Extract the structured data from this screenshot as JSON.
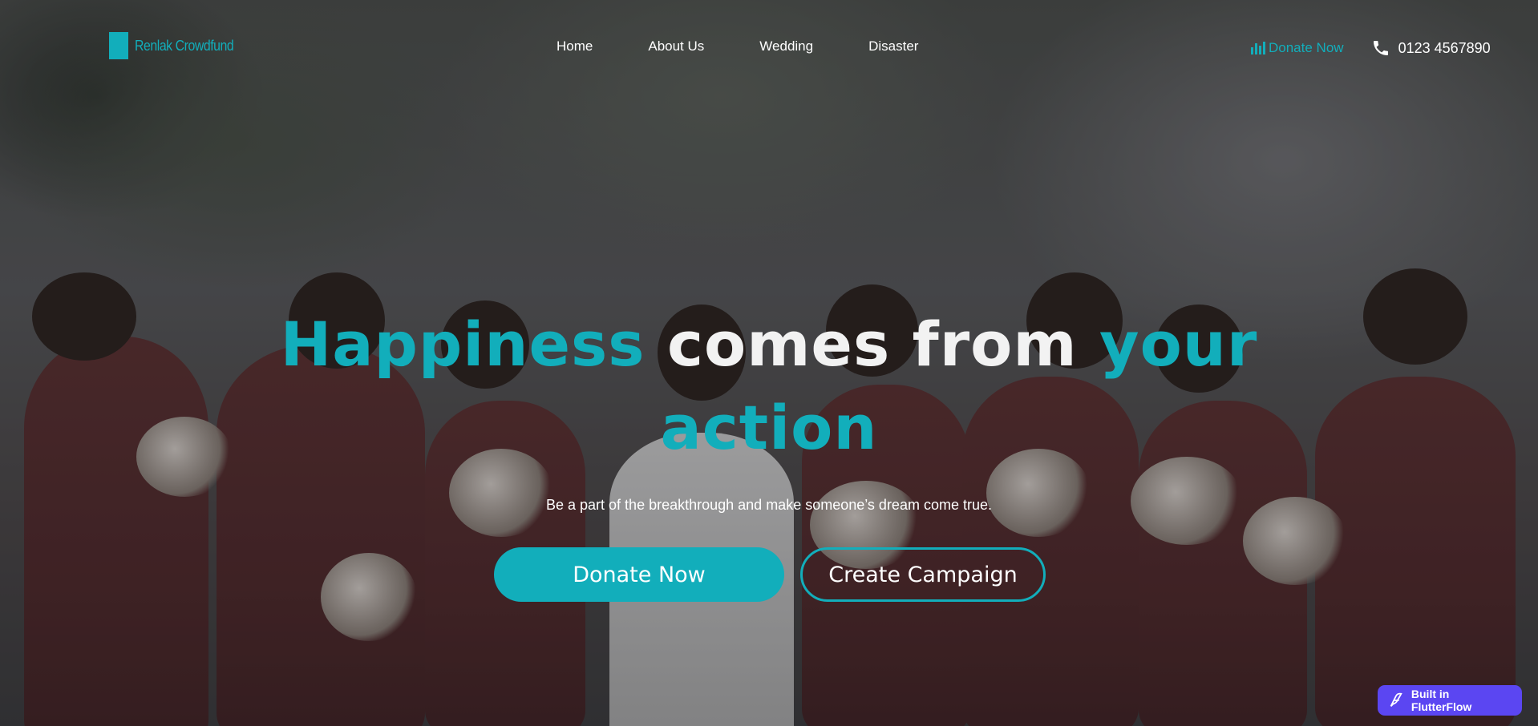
{
  "brand": {
    "name": "Renlak Crowdfund"
  },
  "nav": {
    "items": [
      "Home",
      "About Us",
      "Wedding",
      "Disaster"
    ]
  },
  "header": {
    "donate_label": "Donate Now",
    "phone": "0123 4567890"
  },
  "hero": {
    "headline_part1": "Happiness",
    "headline_part2": " comes from ",
    "headline_part3": "your",
    "headline_part4": "action",
    "subtitle": "Be a part of the breakthrough and make someone’s dream come true.",
    "primary_button": "Donate Now",
    "secondary_button": "Create Campaign"
  },
  "badge": {
    "label": "Built in FlutterFlow"
  },
  "colors": {
    "accent": "#12aebb",
    "badge": "#5b46f2"
  },
  "icons": [
    "chart-bars-icon",
    "phone-icon",
    "flutterflow-icon"
  ]
}
